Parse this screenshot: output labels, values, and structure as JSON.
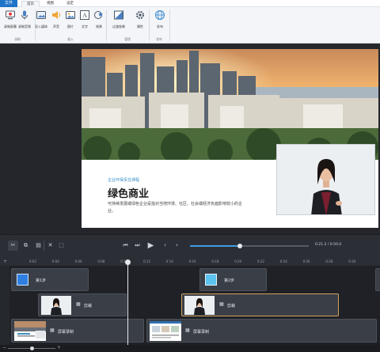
{
  "ribbon": {
    "file_tab": "文件",
    "tabs": [
      "首页",
      "视图",
      "设定"
    ],
    "buttons": {
      "record_screen": "录制屏幕",
      "record_audio": "录制音频",
      "import_media": "导入媒体",
      "audio": "声音",
      "image": "图片",
      "text": "文字",
      "effects": "效果",
      "transitions": "过渡效果",
      "properties": "属性",
      "publish": "发布"
    },
    "groups": {
      "record": "录制",
      "insert": "插入",
      "manage": "管理",
      "publish": "发布"
    }
  },
  "slide": {
    "subtitle": "企业环保责任课程",
    "title": "绿色商业",
    "body": "可持续发展或绿色企业是指对当地环境、社区、社会或经济负面影响较小的企业。"
  },
  "toolbar": {
    "timecode": "0:21.2 / 0:50.0",
    "playback_progress": 0.42
  },
  "timeline": {
    "ruler_ticks": [
      "0:02",
      "0:04",
      "0:06",
      "0:08",
      "0:10",
      "0:12",
      "0:14",
      "0:16",
      "0:18",
      "0:20",
      "0:22",
      "0:24",
      "0:26",
      "0:28",
      "0:30"
    ],
    "clips": {
      "step1": "第1步",
      "step2": "第2步",
      "cutout1": "剪裁",
      "cutout2": "剪裁",
      "screen1": "屏幕录制",
      "screen2": "屏幕录制"
    }
  },
  "colors": {
    "accent": "#3f9be0",
    "file_tab": "#1e74c9",
    "selected_clip": "#d0a35a",
    "step1_icon": "#2f7fe0",
    "step2_icon": "#5bc2ef"
  }
}
